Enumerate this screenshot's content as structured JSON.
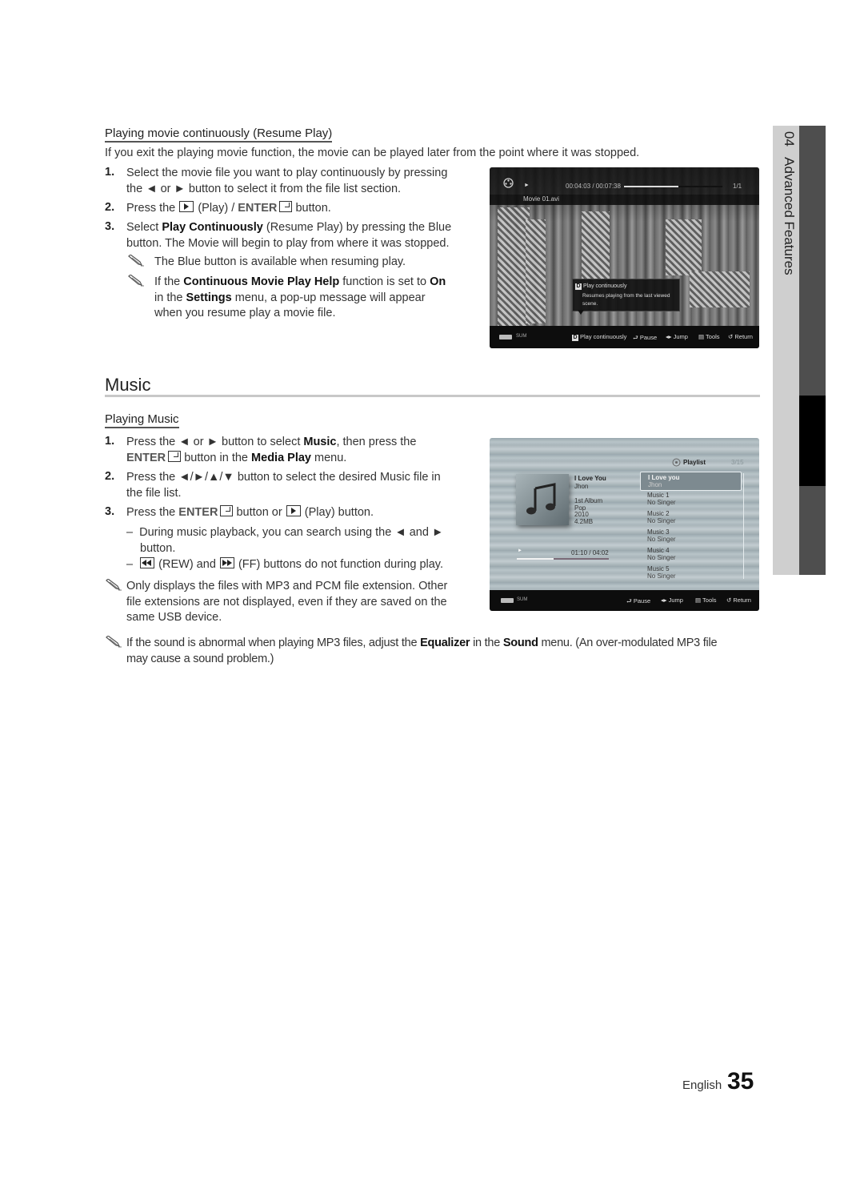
{
  "side_tab": {
    "chapter": "04",
    "title": "Advanced Features"
  },
  "resume": {
    "heading": "Playing movie continuously (Resume Play)",
    "intro": "If you exit the playing movie function, the movie can be played later from the point where it was stopped.",
    "steps": [
      {
        "num": "1.",
        "line1": "Select the movie file you want to play continuously by pressing",
        "line2_a": "the",
        "line2_b": "or",
        "line2_c": "button to select it from the file list section."
      },
      {
        "num": "2.",
        "a": "Press the",
        "b": "(Play) /",
        "enter": "ENTER",
        "c": "button."
      },
      {
        "num": "3.",
        "a": "Select",
        "bold": "Play Continuously",
        "b": "(Resume Play) by pressing the Blue",
        "line2": "button. The Movie will begin to play from where it was stopped."
      }
    ],
    "notes": [
      {
        "text": "The Blue button is available when resuming play."
      },
      {
        "a": "If the",
        "b1": "Continuous Movie Play Help",
        "c": "function is set to",
        "b2": "On",
        "d": "in the",
        "b3": "Settings",
        "e": "menu, a pop-up message will appear",
        "f": "when you resume play a movie file."
      }
    ]
  },
  "movie_screen": {
    "time": "00:04:03 / 00:07:38",
    "progress": 0.55,
    "count": "1/1",
    "filename": "Movie 01.avi",
    "popup_key": "D",
    "popup_title": "Play continuously",
    "popup_body_1": "Resumes playing from the last viewed",
    "popup_body_2": "scene.",
    "device": "SUM",
    "controls": [
      {
        "icon": "blue-d-key",
        "label": "Play continuously"
      },
      {
        "icon": "enter-icon",
        "label": "Pause"
      },
      {
        "icon": "left-right-icon",
        "label": "Jump"
      },
      {
        "icon": "tools-icon",
        "label": "Tools"
      },
      {
        "icon": "return-icon",
        "label": "Return"
      }
    ]
  },
  "music": {
    "section_title": "Music",
    "heading": "Playing Music",
    "steps": [
      {
        "num": "1.",
        "a": "Press the",
        "b": "or",
        "c": "button to select",
        "bold1": "Music",
        "d": ", then press the",
        "enter": "ENTER",
        "e": "button in the",
        "bold2": "Media Play",
        "f": "menu."
      },
      {
        "num": "2.",
        "a": "Press the",
        "arrows": "◄/►/▲/▼",
        "b": "button to select the desired Music file in",
        "line2": "the file list."
      },
      {
        "num": "3.",
        "a": "Press the",
        "enter": "ENTER",
        "b": "button or",
        "c": "(Play) button."
      }
    ],
    "dashes": [
      {
        "dash": "–",
        "a": "During music playback, you can search using the",
        "b": "and",
        "line2": "button."
      },
      {
        "dash": "–",
        "a": "(REW) and",
        "b": "(FF) buttons do not function during play."
      }
    ],
    "note1": {
      "line1": "Only displays the files with MP3 and PCM file extension. Other",
      "line2": "file extensions are not displayed, even if they are saved on the",
      "line3": "same USB device."
    },
    "note2": {
      "a": "If the sound is abnormal when playing MP3 files, adjust the",
      "b1": "Equalizer",
      "c": "in the",
      "b2": "Sound",
      "d": "menu. (An over-modulated MP3 file",
      "line2": "may cause a sound problem.)"
    }
  },
  "music_screen": {
    "playlist_label": "Playlist",
    "playlist_count": "3/15",
    "song_title": "I Love You",
    "artist": "Jhon",
    "album": "1st Album",
    "genre": "Pop",
    "year": "2010",
    "size": "4.2MB",
    "time": "01:10 / 04:02",
    "progress": 0.4,
    "device": "SUM",
    "playlist": [
      {
        "title": "I Love you",
        "artist": "Jhon",
        "selected": true
      },
      {
        "title": "Music 1",
        "artist": "No Singer"
      },
      {
        "title": "Music 2",
        "artist": "No Singer"
      },
      {
        "title": "Music 3",
        "artist": "No Singer"
      },
      {
        "title": "Music 4",
        "artist": "No Singer"
      },
      {
        "title": "Music 5",
        "artist": "No Singer"
      }
    ],
    "controls": [
      {
        "icon": "enter-icon",
        "label": "Pause"
      },
      {
        "icon": "left-right-icon",
        "label": "Jump"
      },
      {
        "icon": "tools-icon",
        "label": "Tools"
      },
      {
        "icon": "return-icon",
        "label": "Return"
      }
    ]
  },
  "footer": {
    "language": "English",
    "page": "35"
  }
}
